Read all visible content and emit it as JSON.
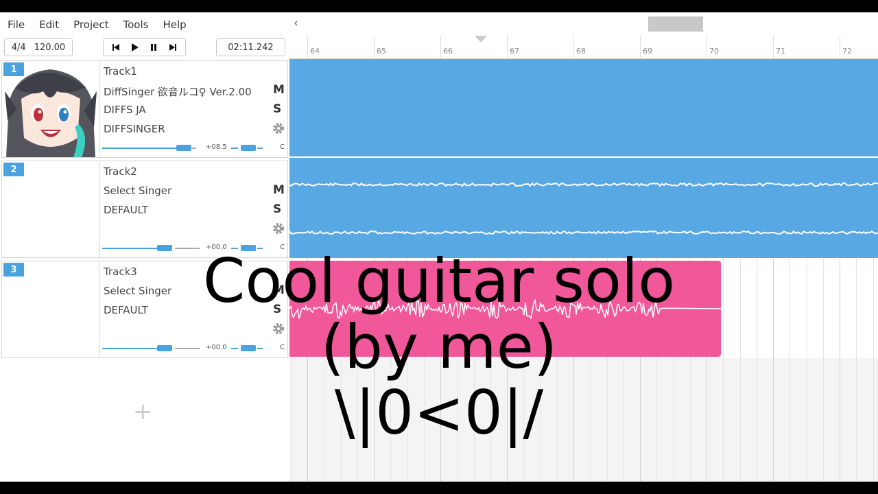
{
  "menu": [
    "File",
    "Edit",
    "Project",
    "Tools",
    "Help"
  ],
  "toolbar": {
    "time_signature": "4/4",
    "bpm": "120.00",
    "time": "02:11.242"
  },
  "tracks": [
    {
      "number": "1",
      "name": "Track1",
      "singer": "DiffSinger 欲音ルコ♀ Ver.2.00",
      "phonemizer": "DIFFS JA",
      "renderer": "DIFFSINGER",
      "mute": "M",
      "solo": "S",
      "volume": "+08.5",
      "pan": "C"
    },
    {
      "number": "2",
      "name": "Track2",
      "singer": "Select Singer",
      "phonemizer": "DEFAULT",
      "renderer": "",
      "mute": "M",
      "solo": "S",
      "volume": "+00.0",
      "pan": "C"
    },
    {
      "number": "3",
      "name": "Track3",
      "singer": "Select Singer",
      "phonemizer": "DEFAULT",
      "renderer": "",
      "mute": "M",
      "solo": "S",
      "volume": "+00.0",
      "pan": "C"
    }
  ],
  "add_track": "+",
  "ruler": {
    "bars": [
      "64",
      "65",
      "66",
      "67",
      "68",
      "69",
      "70",
      "71",
      "72"
    ]
  },
  "colors": {
    "accent": "#4aa3df",
    "part_blue": "#58a8e3",
    "part_pink": "#f0589a"
  },
  "caption": [
    "Cool guitar solo",
    "(by me)",
    "\\|0<0|/"
  ]
}
